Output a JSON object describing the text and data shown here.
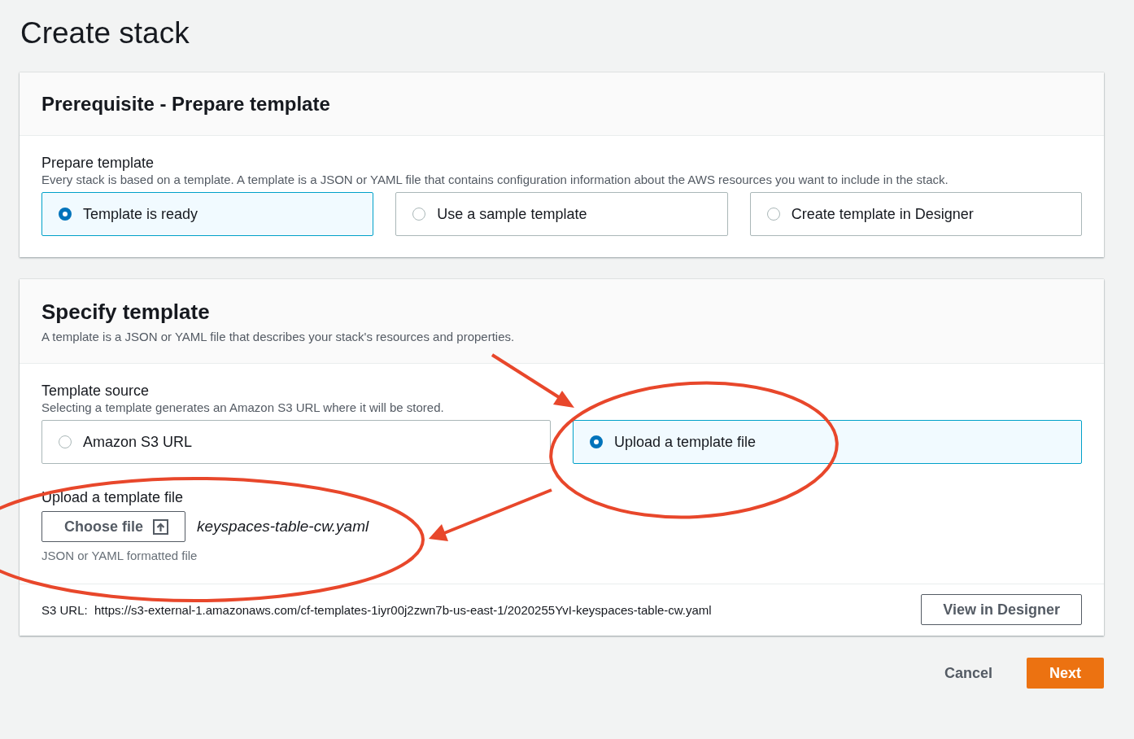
{
  "page_title": "Create stack",
  "prerequisite": {
    "title": "Prerequisite - Prepare template",
    "field_label": "Prepare template",
    "description": "Every stack is based on a template. A template is a JSON or YAML file that contains configuration information about the AWS resources you want to include in the stack.",
    "options": [
      {
        "label": "Template is ready",
        "selected": true
      },
      {
        "label": "Use a sample template",
        "selected": false
      },
      {
        "label": "Create template in Designer",
        "selected": false
      }
    ]
  },
  "specify": {
    "title": "Specify template",
    "subtitle": "A template is a JSON or YAML file that describes your stack's resources and properties.",
    "source_label": "Template source",
    "source_description": "Selecting a template generates an Amazon S3 URL where it will be stored.",
    "options": [
      {
        "label": "Amazon S3 URL",
        "selected": false
      },
      {
        "label": "Upload a template file",
        "selected": true
      }
    ],
    "upload": {
      "label": "Upload a template file",
      "button": "Choose file",
      "file_name": "keyspaces-table-cw.yaml",
      "hint": "JSON or YAML formatted file"
    },
    "s3_url": {
      "label": "S3 URL:",
      "value": "https://s3-external-1.amazonaws.com/cf-templates-1iyr00j2zwn7b-us-east-1/2020255YvI-keyspaces-table-cw.yaml",
      "button": "View in Designer"
    }
  },
  "actions": {
    "cancel": "Cancel",
    "next": "Next"
  }
}
